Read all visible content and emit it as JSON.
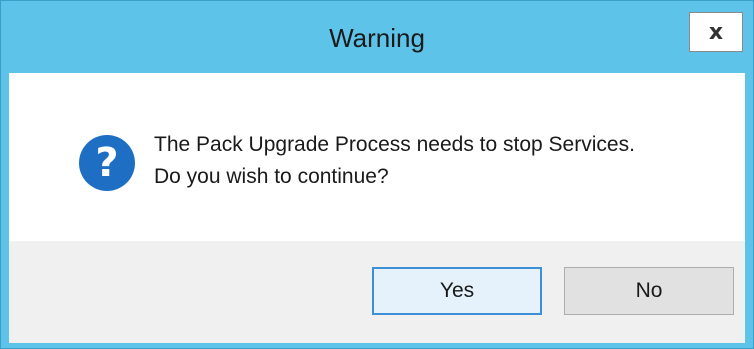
{
  "window": {
    "title": "Warning",
    "close_label": "x"
  },
  "icon": {
    "name": "question-icon",
    "glyph": "?",
    "color": "#1e6fc4"
  },
  "message": {
    "line1": "The Pack Upgrade Process needs to stop Services.",
    "line2": "Do you wish to continue?"
  },
  "buttons": {
    "yes_label": "Yes",
    "no_label": "No"
  },
  "colors": {
    "titlebar": "#5ec3e9",
    "button_face": "#e1e1e1",
    "default_button_border": "#3d8fd6"
  }
}
